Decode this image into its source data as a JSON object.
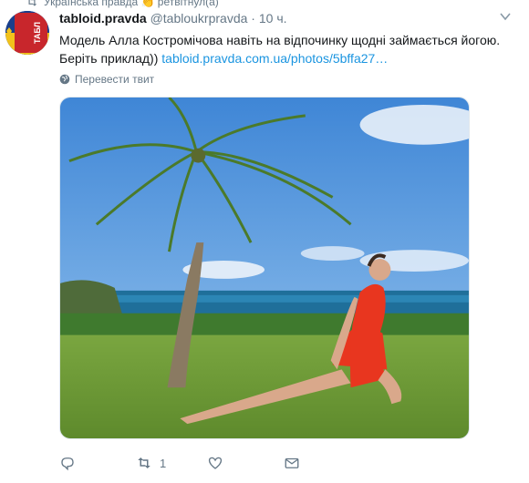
{
  "retweet_context": {
    "text": "Українська правда 👏 ретвітнул(а)"
  },
  "tweet": {
    "author_name": "tabloid.pravda",
    "author_handle": "@tabloukrpravda",
    "separator": "·",
    "time": "10 ч.",
    "text_line1": "Модель Алла Костромічова навіть на відпочинку щодні займається йогою.",
    "text_line2_prefix": "Беріть приклад)) ",
    "link": "tabloid.pravda.com.ua/photos/5bffa27…",
    "translate_label": "Перевести твит",
    "avatar_text": "ТАБЛ"
  },
  "actions": {
    "reply_count": "",
    "retweet_count": "1",
    "like_count": "",
    "dm_label": ""
  },
  "icons": {
    "retweet": "retweet-icon",
    "globe": "globe-icon",
    "caret": "chevron-down-icon",
    "reply": "reply-icon",
    "like": "heart-icon",
    "dm": "envelope-icon"
  },
  "colors": {
    "link": "#1b95e0",
    "muted": "#657786",
    "text": "#14171a",
    "sky": "#4a8fd6",
    "swimsuit": "#e8361f",
    "grass": "#6f9a3a"
  }
}
